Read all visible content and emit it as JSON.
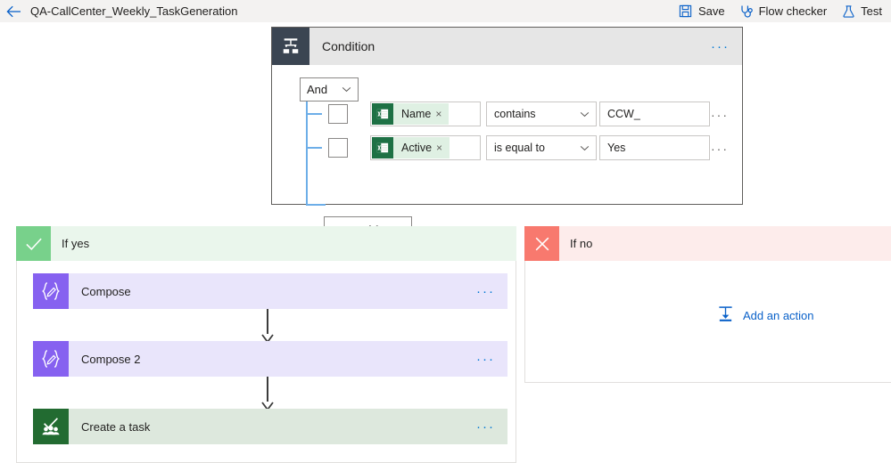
{
  "topbar": {
    "back_icon": "back-arrow-icon",
    "flow_title": "QA-CallCenter_Weekly_TaskGeneration",
    "commands": [
      {
        "label": "Save",
        "icon": "save-floppy-icon"
      },
      {
        "label": "Flow checker",
        "icon": "stethoscope-icon"
      },
      {
        "label": "Test",
        "icon": "flask-icon"
      }
    ]
  },
  "condition": {
    "icon": "condition-branch-icon",
    "title": "Condition",
    "more_menu": "···",
    "logic_operator": {
      "label": "And",
      "chevron": "chevron-down-icon"
    },
    "rows": [
      {
        "checkbox_checked": false,
        "token": {
          "label": "Name",
          "icon": "excel-icon",
          "remove": "×"
        },
        "operator": "contains",
        "operator_chevron": "chevron-down-icon",
        "value": "CCW_",
        "more_menu": "···"
      },
      {
        "checkbox_checked": false,
        "token": {
          "label": "Active",
          "icon": "excel-icon",
          "remove": "×"
        },
        "operator": "is equal to",
        "operator_chevron": "chevron-down-icon",
        "value": "Yes",
        "more_menu": "···"
      }
    ],
    "add_button": {
      "plus": "+",
      "label": "Add",
      "chevron": "chevron-down-icon"
    }
  },
  "branches": {
    "yes": {
      "title": "If yes",
      "badge_icon": "checkmark-icon",
      "actions": [
        {
          "title": "Compose",
          "icon": "compose-icon",
          "more_menu": "···"
        },
        {
          "title": "Compose 2",
          "icon": "compose-icon",
          "more_menu": "···"
        },
        {
          "title": "Create a task",
          "icon": "planner-task-icon",
          "more_menu": "···"
        }
      ]
    },
    "no": {
      "title": "If no",
      "badge_icon": "cross-icon",
      "add_action": {
        "label": "Add an action",
        "icon": "add-action-icon"
      }
    }
  },
  "colors": {
    "command_link": "#0a61c9",
    "condition_icon_bg": "#3b4552",
    "condition_header_bg": "#e6e6e6",
    "tree_line": "#6daee8",
    "token_bg": "#dff0e3",
    "token_icon_bg": "#1e7145",
    "yes_header_bg": "#eaf6ec",
    "yes_badge_bg": "#78d18b",
    "no_header_bg": "#fdeceb",
    "no_badge_bg": "#f8796e",
    "compose_card_bg": "#e9e5fb",
    "compose_icon_bg": "#8661f0",
    "task_card_bg": "#dde8dd",
    "task_icon_bg": "#226b31"
  }
}
